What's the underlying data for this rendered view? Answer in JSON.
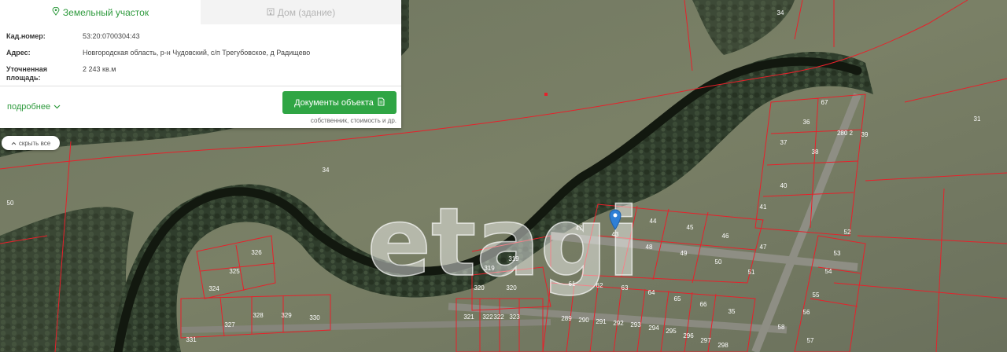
{
  "panel": {
    "tabs": [
      {
        "label": "Земельный участок",
        "active": true
      },
      {
        "label": "Дом (здание)",
        "active": false
      }
    ],
    "fields": [
      {
        "label": "Кад.номер:",
        "value": "53:20:0700304:43"
      },
      {
        "label": "Адрес:",
        "value": "Новгородская область, р-н Чудовский, с/п Трегубовское, д Радищево"
      },
      {
        "label": "Уточненная площадь:",
        "value": "2 243 кв.м"
      }
    ],
    "more_label": "подробнее",
    "docs_button_label": "Документы объекта",
    "docs_subtext": "собственник, стоимость и др."
  },
  "hide_all_label": "скрыть все",
  "map": {
    "watermark": "etagi",
    "selected_plot": "43",
    "colors": {
      "boundary": "#e8202a",
      "marker": "#2f7fd6",
      "accent": "#2fa544"
    },
    "plot_labels": [
      "34",
      "34",
      "50",
      "67",
      "36",
      "37",
      "38",
      "39",
      "280 2",
      "31",
      "40",
      "41",
      "44",
      "45",
      "46",
      "47",
      "43",
      "48",
      "49",
      "50",
      "51",
      "52",
      "53",
      "54",
      "55",
      "56",
      "57",
      "58",
      "326",
      "325",
      "324",
      "327",
      "328",
      "329",
      "330",
      "331",
      "319",
      "320",
      "320",
      "321",
      "322",
      "322",
      "323",
      "61",
      "62",
      "63",
      "64",
      "65",
      "66",
      "35",
      "289",
      "290",
      "291",
      "292",
      "293",
      "294",
      "295",
      "296",
      "297",
      "298",
      "47",
      "319"
    ]
  }
}
